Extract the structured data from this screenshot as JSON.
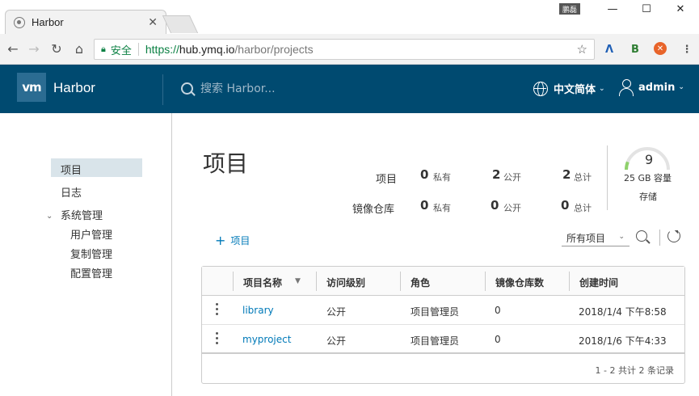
{
  "browser": {
    "tab_title": "Harbor",
    "profile_badge": "鹏磊",
    "url": {
      "secure_label": "安全",
      "scheme": "https://",
      "host": "hub.ymq.io",
      "path": "/harbor/projects"
    }
  },
  "header": {
    "logo_text": "vm",
    "brand": "Harbor",
    "search_placeholder": "搜索 Harbor...",
    "language": "中文简体",
    "username": "admin"
  },
  "sidebar": {
    "items": [
      {
        "label": "项目",
        "active": true
      },
      {
        "label": "日志"
      }
    ],
    "group": {
      "label": "系统管理",
      "children": [
        {
          "label": "用户管理"
        },
        {
          "label": "复制管理"
        },
        {
          "label": "配置管理"
        }
      ]
    }
  },
  "main": {
    "title": "项目",
    "stats": {
      "rows": [
        {
          "label": "项目",
          "private_count": "0",
          "public_count": "2",
          "total_count": "2"
        },
        {
          "label": "镜像仓库",
          "private_count": "0",
          "public_count": "0",
          "total_count": "0"
        }
      ],
      "private_label": "私有",
      "public_label": "公开",
      "total_label": "总计"
    },
    "storage": {
      "count": "9",
      "capacity": "25 GB 容量",
      "label": "存储",
      "fill_fraction": 0.12
    },
    "add_project_label": "项目",
    "filter": {
      "selected": "所有项目"
    },
    "table": {
      "columns": [
        "项目名称",
        "访问级别",
        "角色",
        "镜像仓库数",
        "创建时间"
      ],
      "rows": [
        {
          "name": "library",
          "access": "公开",
          "role": "项目管理员",
          "repo_count": "0",
          "created": "2018/1/4 下午8:58"
        },
        {
          "name": "myproject",
          "access": "公开",
          "role": "项目管理员",
          "repo_count": "0",
          "created": "2018/1/6 下午4:33"
        }
      ],
      "footer": "1 - 2 共计 2 条记录"
    }
  },
  "colors": {
    "header_bg": "#004a70",
    "link": "#0079b8",
    "sidebar_active": "#d9e4ea",
    "gauge": "#8fd16c"
  }
}
